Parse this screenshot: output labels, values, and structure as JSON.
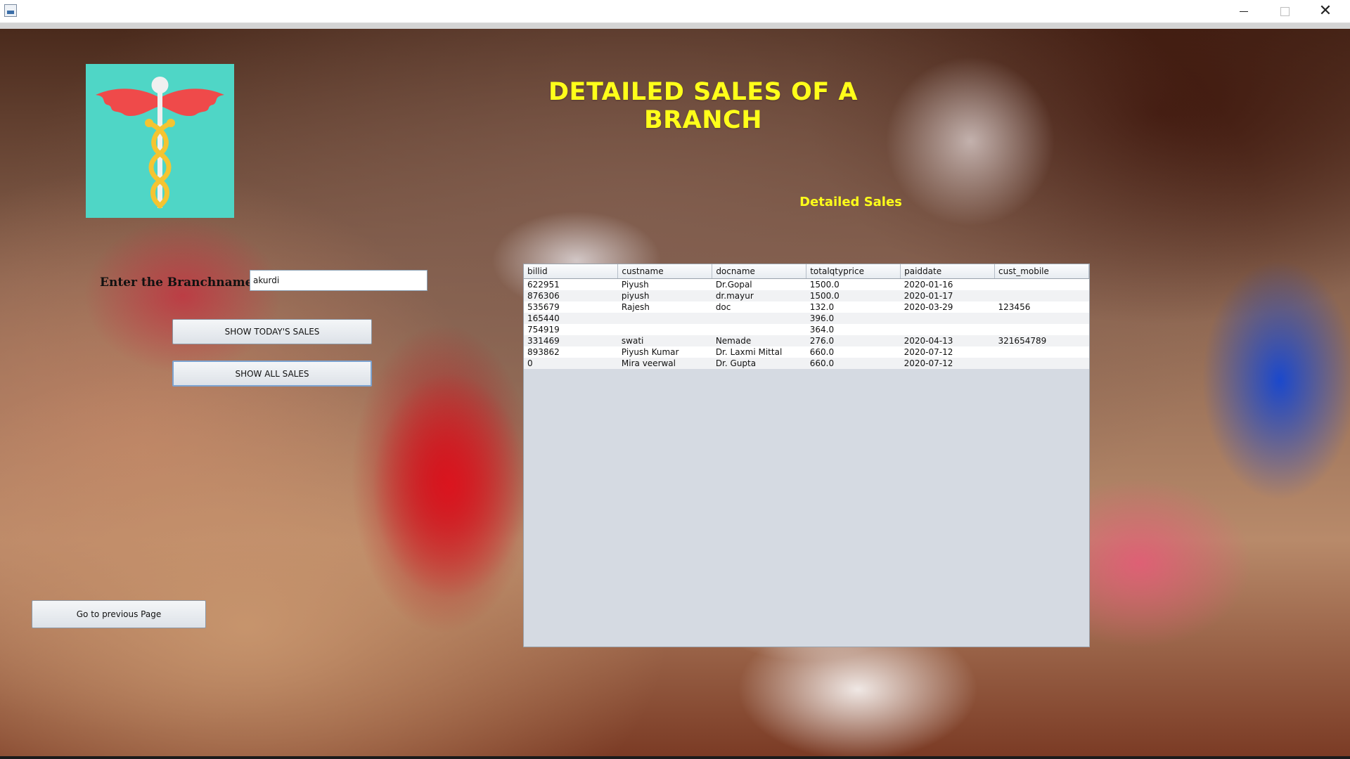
{
  "window": {
    "title": "",
    "controls": {
      "minimize": "─",
      "maximize": "□",
      "close": "✕"
    }
  },
  "header": {
    "title": "DETAILED SALES OF A BRANCH",
    "subtitle": "Detailed Sales"
  },
  "form": {
    "branch_label": "Enter the Branchname  :",
    "branch_value": "akurdi"
  },
  "buttons": {
    "today": "SHOW TODAY'S SALES",
    "all": "SHOW ALL SALES",
    "previous": "Go to previous Page"
  },
  "table": {
    "columns": [
      "billid",
      "custname",
      "docname",
      "totalqtyprice",
      "paiddate",
      "cust_mobile"
    ],
    "rows": [
      [
        "622951",
        "Piyush",
        "Dr.Gopal",
        "1500.0",
        "2020-01-16",
        ""
      ],
      [
        "876306",
        "piyush",
        "dr.mayur",
        "1500.0",
        "2020-01-17",
        ""
      ],
      [
        "535679",
        "Rajesh",
        "doc",
        "132.0",
        "2020-03-29",
        "123456"
      ],
      [
        "165440",
        "",
        "",
        "396.0",
        "",
        ""
      ],
      [
        "754919",
        "",
        "",
        "364.0",
        "",
        ""
      ],
      [
        "331469",
        "swati",
        "Nemade",
        "276.0",
        "2020-04-13",
        "321654789"
      ],
      [
        "893862",
        "Piyush Kumar",
        "Dr. Laxmi Mittal",
        "660.0",
        "2020-07-12",
        ""
      ],
      [
        "0",
        "Mira veerwal",
        "Dr. Gupta",
        "660.0",
        "2020-07-12",
        ""
      ]
    ]
  },
  "logo": {
    "icon": "caduceus-icon",
    "bg_color": "#4fd6c6"
  },
  "colors": {
    "title": "#ffff1a",
    "accent_wings": "#ef4a4a",
    "snakes": "#f5c431"
  }
}
